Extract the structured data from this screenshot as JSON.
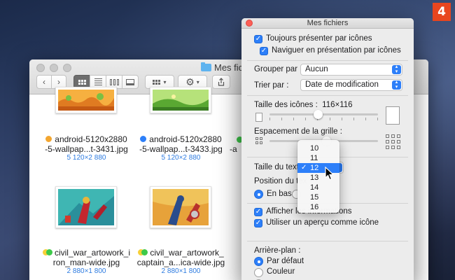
{
  "step_badge": "4",
  "finder": {
    "title": "Mes fichiers",
    "files": [
      {
        "name_line1": "android-5120x2880",
        "name_line2": "-5-wallpap...t-3431.jpg",
        "dims": "5 120×2 880",
        "tag_color": "#f3a630"
      },
      {
        "name_line1": "android-5120x2880",
        "name_line2": "-5-wallpap...t-3433.jpg",
        "dims": "5 120×2 880",
        "tag_color": "#2d7ff9"
      },
      {
        "name_line1": "civil_war_artowork_i",
        "name_line2": "ron_man-wide.jpg",
        "dims": "2 880×1 800",
        "tag_colors": [
          "#f7d038",
          "#3ec94a"
        ]
      },
      {
        "name_line1": "civil_war_artowork_",
        "name_line2": "captain_a...ica-wide.jpg",
        "dims": "2 880×1 800",
        "tag_colors": [
          "#f7d038",
          "#3ec94a"
        ]
      }
    ],
    "partial_label": "-a"
  },
  "panel": {
    "title": "Mes fichiers",
    "always_icons": "Toujours présenter par icônes",
    "browse_icons": "Naviguer en présentation par icônes",
    "group_by_label": "Grouper par :",
    "group_by_value": "Aucun",
    "sort_by_label": "Trier par :",
    "sort_by_value": "Date de modification",
    "icon_size_label": "Taille des icônes :",
    "icon_size_value": "116×116",
    "grid_spacing_label": "Espacement de la grille :",
    "text_size_label": "Taille du texte",
    "text_position_label": "Position du tex",
    "position_bottom": "En bas",
    "show_info": "Afficher les informations",
    "use_preview": "Utiliser un aperçu comme icône",
    "background_label": "Arrière-plan :",
    "bg_default": "Par défaut",
    "bg_color": "Couleur"
  },
  "font_size_menu": {
    "options": [
      "10",
      "11",
      "12",
      "13",
      "14",
      "15",
      "16"
    ],
    "selected": "12"
  }
}
